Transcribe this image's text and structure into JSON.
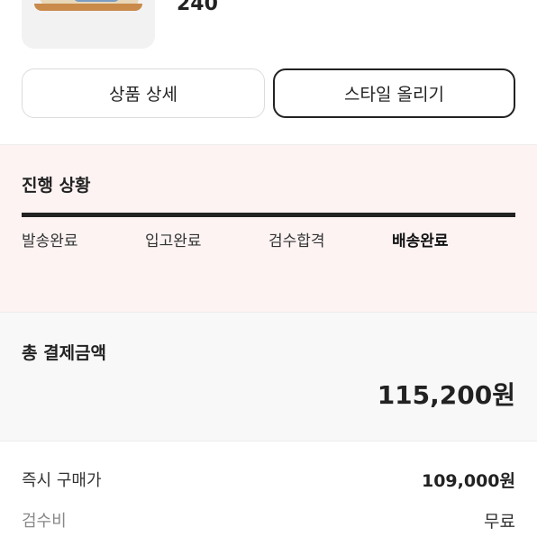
{
  "product": {
    "size": "240"
  },
  "buttons": {
    "detail_label": "상품 상세",
    "style_label": "스타일 올리기"
  },
  "progress": {
    "title": "진행 상황",
    "steps": [
      "발송완료",
      "입고완료",
      "검수합격",
      "배송완료"
    ],
    "current_step": "배송완료",
    "colors": {
      "background": "#fdf3f3",
      "bar": "#222222"
    }
  },
  "payment": {
    "total_label": "총 결제금액",
    "total_value": "115,200원",
    "rows": [
      {
        "label": "즉시 구매가",
        "value": "109,000원"
      },
      {
        "label": "검수비",
        "value": "무료"
      }
    ]
  }
}
